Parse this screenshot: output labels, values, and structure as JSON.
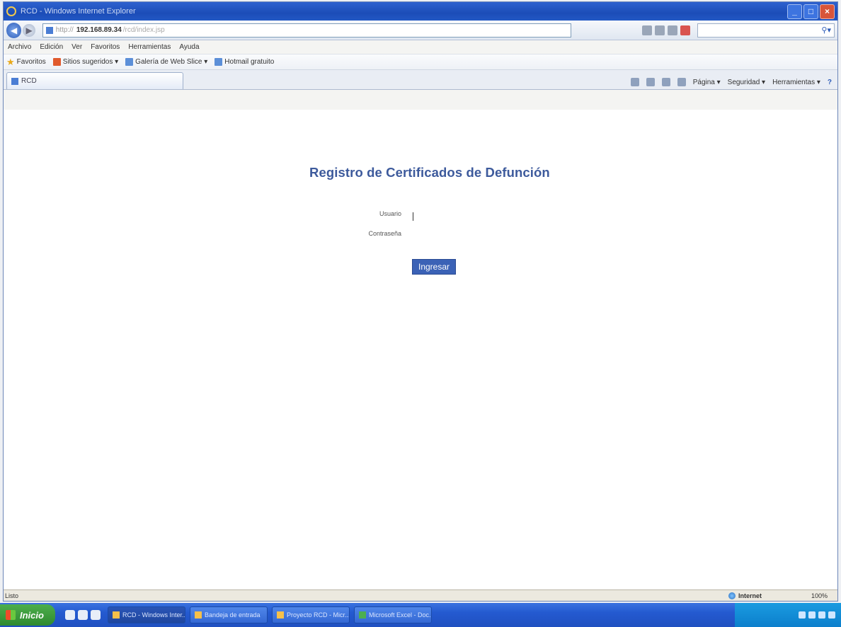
{
  "window": {
    "title": "RCD - Windows Internet Explorer"
  },
  "address": {
    "protocol": "http://",
    "host": "192.168.89.34",
    "path": "/rcd/index.jsp"
  },
  "search": {
    "placeholder": "",
    "icon": "magnifier-icon"
  },
  "menu": [
    "Archivo",
    "Edición",
    "Ver",
    "Favoritos",
    "Herramientas",
    "Ayuda"
  ],
  "favorites": {
    "label": "Favoritos",
    "items": [
      "Sitios sugeridos ▾",
      "Galería de Web Slice ▾",
      "Hotmail gratuito"
    ]
  },
  "tab": {
    "label": "RCD"
  },
  "commandbar": {
    "page": "Página ▾",
    "security": "Seguridad ▾",
    "tools": "Herramientas ▾",
    "help": "?"
  },
  "page": {
    "title": "Registro de Certificados de Defunción",
    "username_label": "Usuario",
    "password_label": "Contraseña",
    "submit_label": "Ingresar"
  },
  "statusbar": {
    "left": "Listo",
    "zone": "Internet",
    "zoom": "100%"
  },
  "taskbar": {
    "start": "Inicio",
    "buttons": [
      "RCD - Windows Inter...",
      "Bandeja de entrada",
      "Proyecto RCD - Micr...",
      "Microsoft Excel - Doc..."
    ]
  },
  "colors": {
    "title": "#3d5a9c",
    "button": "#3b62b6",
    "titlebar": "#1c4db8"
  }
}
